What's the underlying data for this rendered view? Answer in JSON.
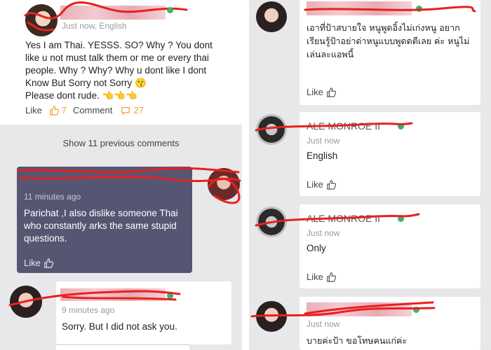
{
  "left": {
    "post": {
      "timestamp": "Just now, English",
      "body": "Yes I am Thai. YESSS. SO? Why ? You dont like u not must talk them or me or every thai people. Why ? Why? Why u dont like I dont Know But Sorry not Sorry 😗\nPlease dont rude. 👈👈👈",
      "like_label": "Like",
      "like_count": "7",
      "comment_label": "Comment",
      "comment_count": "27"
    },
    "show_previous": "Show 11 previous comments",
    "comment1": {
      "timestamp": "11 minutes ago",
      "body": "Parichat ,I also dislike someone Thai who constantly arks the same stupid questions.",
      "like_label": "Like"
    },
    "comment2": {
      "timestamp": "9 minutes ago",
      "body": "Sorry. But I did not ask you."
    }
  },
  "right": {
    "comment1": {
      "body": "เอาที่ป้าสบายใจ หนูพูดอิ้งไม่เก่งหนู อยากเรียนรู้ป้าอย่าด่าหนูแบบพูดดตีเลย ค่ะ หนูไม่เล่นละแอพนี้",
      "like_label": "Like"
    },
    "comment2": {
      "name": "ALE MONROE  II",
      "timestamp": "Just now",
      "body": "English",
      "like_label": "Like"
    },
    "comment3": {
      "name": "ALE MONROE  II",
      "timestamp": "Just now",
      "body": "Only",
      "like_label": "Like"
    },
    "comment4": {
      "timestamp": "Just now",
      "body": "บายค่ะป้า ขอโทษคนแก่ค่ะ"
    }
  },
  "colors": {
    "redaction": "#e8201f",
    "online": "#3bb36a",
    "highlight_card": "#565672",
    "like_icon_orange": "#f0a030",
    "comment_icon_orange": "#f0a030"
  },
  "icons": [
    "thumbs-up-icon",
    "speech-bubble-icon",
    "online-dot-icon"
  ]
}
